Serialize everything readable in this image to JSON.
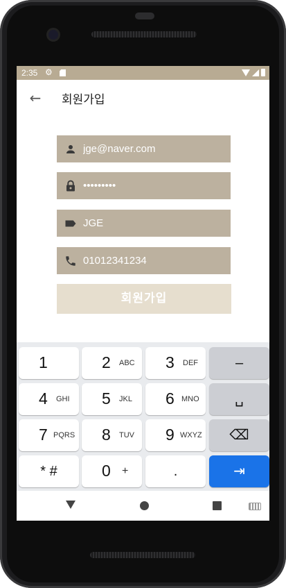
{
  "status_bar": {
    "time": "2:35",
    "settings_icon": "gear-icon",
    "sd_icon": "sd-card-icon"
  },
  "appbar": {
    "back_icon": "arrow-left-icon",
    "title": "회원가입"
  },
  "form": {
    "email": {
      "value": "jge@naver.com",
      "icon": "person-icon"
    },
    "password": {
      "value": "•••••••••",
      "icon": "lock-icon"
    },
    "name": {
      "value": "JGE",
      "icon": "label-tag-icon"
    },
    "phone": {
      "value": "01012341234",
      "icon": "phone-icon"
    },
    "submit_label": "회원가입"
  },
  "keyboard": {
    "rows": [
      [
        {
          "num": "1",
          "letters": ""
        },
        {
          "num": "2",
          "letters": "ABC"
        },
        {
          "num": "3",
          "letters": "DEF"
        },
        {
          "special": "–"
        }
      ],
      [
        {
          "num": "4",
          "letters": "GHI"
        },
        {
          "num": "5",
          "letters": "JKL"
        },
        {
          "num": "6",
          "letters": "MNO"
        },
        {
          "special": "␣"
        }
      ],
      [
        {
          "num": "7",
          "letters": "PQRS"
        },
        {
          "num": "8",
          "letters": "TUV"
        },
        {
          "num": "9",
          "letters": "WXYZ"
        },
        {
          "special": "⌫"
        }
      ],
      [
        {
          "special": "* #"
        },
        {
          "num": "0",
          "letters": "+"
        },
        {
          "special": "."
        },
        {
          "special": "⇥"
        }
      ]
    ]
  },
  "nav_bar": {
    "back_icon": "triangle-back-icon",
    "home_icon": "circle-home-icon",
    "recents_icon": "square-recents-icon",
    "keyboard_icon": "keyboard-icon"
  },
  "colors": {
    "accent": "#bcb19f",
    "status_bar": "#b8ab93",
    "button_disabled": "#e6dece",
    "key_blue": "#1a73e8"
  }
}
